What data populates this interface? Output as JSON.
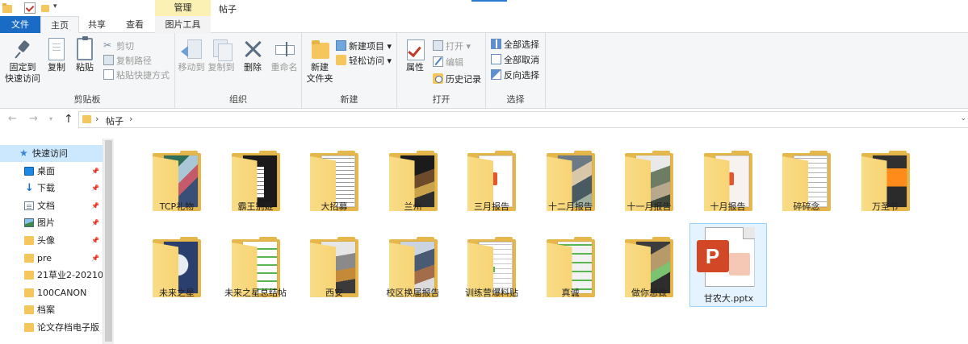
{
  "window": {
    "title": "帖子",
    "context_tab_group": "管理",
    "accent_color": "#1a6bc6"
  },
  "tabs": {
    "file": "文件",
    "home": "主页",
    "share": "共享",
    "view": "查看",
    "picture_tools": "图片工具"
  },
  "ribbon": {
    "clipboard": {
      "label": "剪贴板",
      "pin_line1": "固定到",
      "pin_line2": "快速访问",
      "copy": "复制",
      "paste": "粘贴",
      "cut": "剪切",
      "copy_path": "复制路径",
      "paste_shortcut": "粘贴快捷方式"
    },
    "organize": {
      "label": "组织",
      "move_to": "移动到",
      "copy_to": "复制到",
      "delete": "删除",
      "rename": "重命名"
    },
    "new": {
      "label": "新建",
      "new_folder_line1": "新建",
      "new_folder_line2": "文件夹",
      "new_item": "新建项目 ▾",
      "easy_access": "轻松访问 ▾"
    },
    "open": {
      "label": "打开",
      "properties": "属性",
      "open": "打开 ▾",
      "edit": "编辑",
      "history": "历史记录"
    },
    "select": {
      "label": "选择",
      "select_all": "全部选择",
      "select_none": "全部取消",
      "invert": "反向选择"
    }
  },
  "address": {
    "crumb": "帖子"
  },
  "nav_pane": {
    "items": [
      {
        "label": "快速访问",
        "icon": "star-icon",
        "pinned": false
      },
      {
        "label": "桌面",
        "icon": "desktop-icon",
        "pinned": true
      },
      {
        "label": "下载",
        "icon": "download-icon",
        "pinned": true
      },
      {
        "label": "文档",
        "icon": "documents-icon",
        "pinned": true
      },
      {
        "label": "图片",
        "icon": "pictures-icon",
        "pinned": true
      },
      {
        "label": "头像",
        "icon": "folder-icon",
        "pinned": true
      },
      {
        "label": "pre",
        "icon": "folder-icon",
        "pinned": true
      },
      {
        "label": "21草业2-20210",
        "icon": "folder-icon",
        "pinned": false
      },
      {
        "label": "100CANON",
        "icon": "folder-icon",
        "pinned": false
      },
      {
        "label": "档案",
        "icon": "folder-icon",
        "pinned": false
      },
      {
        "label": "论文存档电子版",
        "icon": "folder-icon",
        "pinned": false
      }
    ]
  },
  "files": [
    {
      "name": "TCP礼物",
      "type": "folder"
    },
    {
      "name": "霸王别姬",
      "type": "folder"
    },
    {
      "name": "大招募",
      "type": "folder"
    },
    {
      "name": "兰州",
      "type": "folder"
    },
    {
      "name": "三月报告",
      "type": "folder"
    },
    {
      "name": "十二月报告",
      "type": "folder"
    },
    {
      "name": "十一月报告",
      "type": "folder"
    },
    {
      "name": "十月报告",
      "type": "folder"
    },
    {
      "name": "碎碎念",
      "type": "folder"
    },
    {
      "name": "万圣节",
      "type": "folder"
    },
    {
      "name": "未来之星",
      "type": "folder"
    },
    {
      "name": "未来之星总结帖",
      "type": "folder"
    },
    {
      "name": "西安",
      "type": "folder"
    },
    {
      "name": "校区换届报告",
      "type": "folder"
    },
    {
      "name": "训练营爆料贴",
      "type": "folder"
    },
    {
      "name": "真诚",
      "type": "folder"
    },
    {
      "name": "做你想做",
      "type": "folder"
    },
    {
      "name": "甘农大.pptx",
      "type": "pptx",
      "selected": true
    }
  ]
}
